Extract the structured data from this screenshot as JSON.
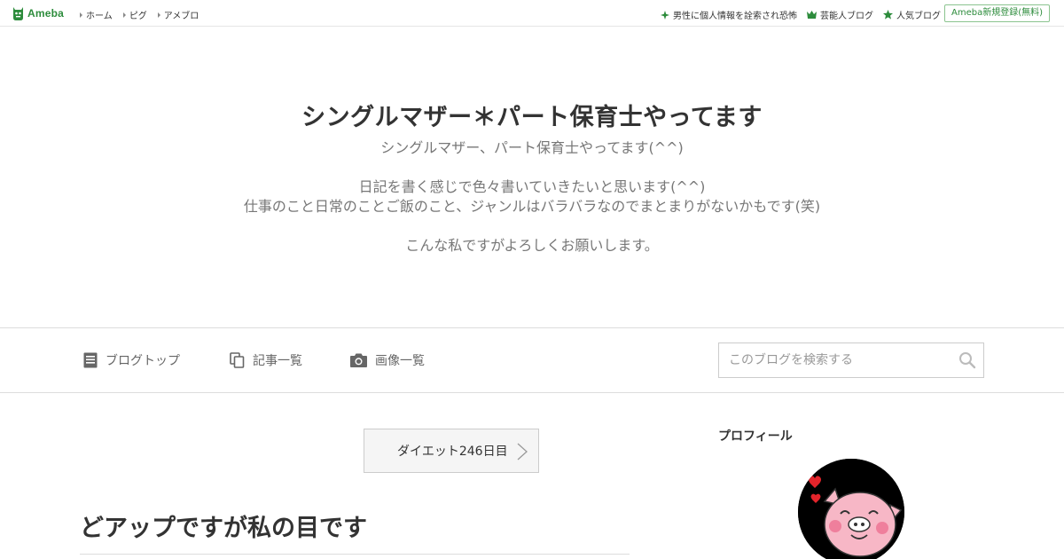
{
  "topbar": {
    "logo_text": "Ameba",
    "nav": [
      "ホーム",
      "ピグ",
      "アメブロ"
    ],
    "right_links": [
      {
        "label": "男性に個人情報を詮索され恐怖",
        "icon": "sparkle-icon"
      },
      {
        "label": "芸能人ブログ",
        "icon": "crown-icon"
      },
      {
        "label": "人気ブログ",
        "icon": "star-icon"
      }
    ],
    "register_label": "Ameba新規登録(無料)"
  },
  "header": {
    "title": "シングルマザー＊パート保育士やってます",
    "description": [
      "シングルマザー、パート保育士やってます(^^)",
      "",
      "日記を書く感じで色々書いていきたいと思います(^^)",
      "仕事のこと日常のことご飯のこと、ジャンルはバラバラなのでまとまりがないかもです(笑)",
      "",
      "こんな私ですがよろしくお願いします。"
    ]
  },
  "nav": {
    "items": [
      {
        "label": "ブログトップ",
        "icon": "document-icon"
      },
      {
        "label": "記事一覧",
        "icon": "copy-icon"
      },
      {
        "label": "画像一覧",
        "icon": "camera-icon"
      }
    ],
    "search_placeholder": "このブログを検索する"
  },
  "article": {
    "prev_link_label": "ダイエット246日目",
    "title": "どアップですが私の目です"
  },
  "sidebar": {
    "profile_heading": "プロフィール"
  },
  "colors": {
    "brand_green": "#2d8c3c",
    "text": "#333333",
    "muted": "#777777"
  }
}
